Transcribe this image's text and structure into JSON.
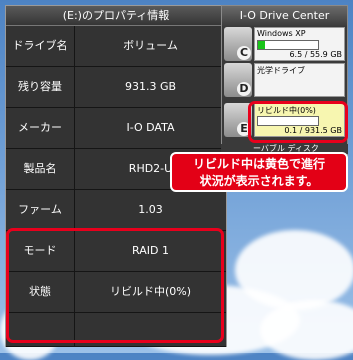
{
  "properties": {
    "title": "(E:)のプロパティ情報",
    "rows": [
      {
        "label": "ドライブ名",
        "value": "ボリューム"
      },
      {
        "label": "残り容量",
        "value": "931.3 GB"
      },
      {
        "label": "メーカー",
        "value": "I-O DATA"
      },
      {
        "label": "製品名",
        "value": "RHD2-U"
      },
      {
        "label": "ファーム",
        "value": "1.03"
      },
      {
        "label": "モード",
        "value": "RAID 1"
      },
      {
        "label": "状態",
        "value": "リビルド中(0%)"
      },
      {
        "label": "",
        "value": ""
      }
    ]
  },
  "drive_center": {
    "title": "I-O Drive Center",
    "items": [
      {
        "letter": "C",
        "name": "Windows XP",
        "size": "6.5 / 55.9 GB",
        "usage_fraction": 0.117,
        "icon": "hard-drive-icon"
      },
      {
        "letter": "D",
        "name": "光学ドライブ",
        "size": "",
        "icon": "optical-drive-icon"
      },
      {
        "letter": "E",
        "name": "リビルド中(0%)",
        "size": "0.1 / 931.5 GB",
        "usage_fraction": 0.0,
        "icon": "hard-drive-icon"
      }
    ],
    "partial_label": "ーバブル ディスク"
  },
  "callout": {
    "line1": "リビルド中は黄色で進行",
    "line2": "状況が表示されます。"
  },
  "colors": {
    "highlight": "#e8001c",
    "rebuild": "#f7f6b0",
    "progress": "#19c419"
  }
}
